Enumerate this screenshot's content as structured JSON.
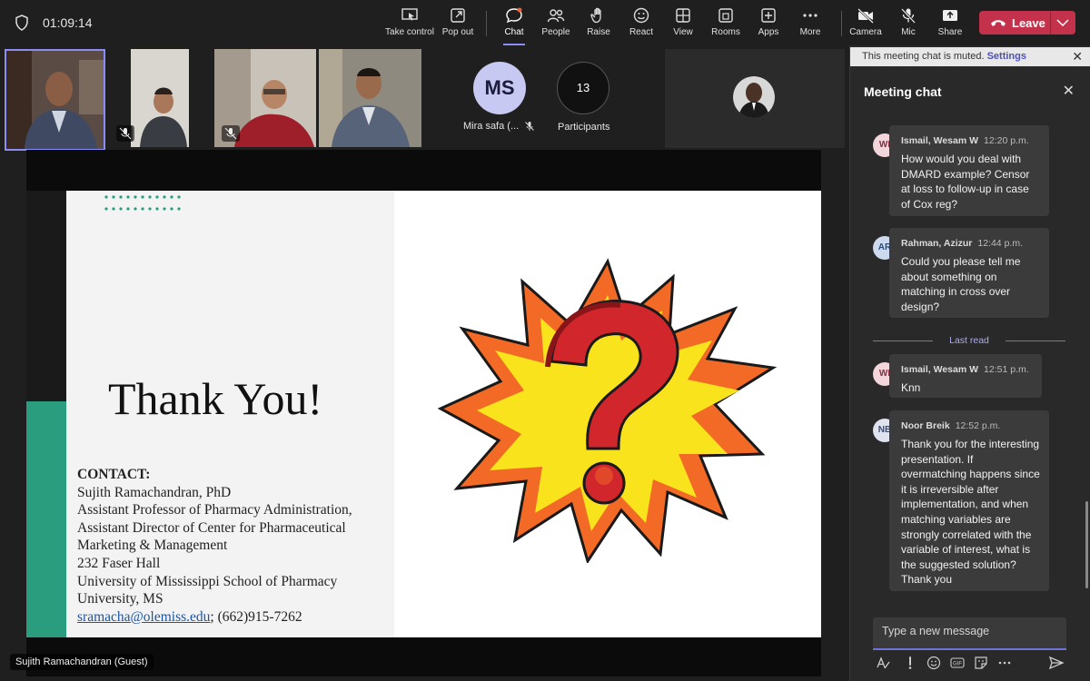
{
  "timer": "01:09:14",
  "toolbar": {
    "take_control": "Take control",
    "pop_out": "Pop out",
    "chat": "Chat",
    "people": "People",
    "raise": "Raise",
    "react": "React",
    "view": "View",
    "rooms": "Rooms",
    "apps": "Apps",
    "more": "More",
    "camera": "Camera",
    "mic": "Mic",
    "share": "Share",
    "leave": "Leave"
  },
  "participants_strip": {
    "avatar_initials": "MS",
    "avatar_name": "Mira safa (...",
    "participant_count": "13",
    "participants_label": "Participants"
  },
  "slide": {
    "thanks": "Thank You!",
    "contact_head": "CONTACT:",
    "contact_lines": [
      "Sujith Ramachandran, PhD",
      "Assistant Professor of Pharmacy Administration,",
      "Assistant Director of Center for Pharmaceutical",
      "Marketing & Management",
      "232 Faser Hall",
      "University of Mississippi School of Pharmacy",
      "University, MS"
    ],
    "email": "sramacha@olemiss.edu",
    "phone": "; (662)915-7262"
  },
  "presenter_label": "Sujith Ramachandran (Guest)",
  "chat_panel": {
    "muted_text": "This meeting chat is muted.",
    "settings": "Settings",
    "title": "Meeting chat",
    "last_read": "Last read",
    "compose_placeholder": "Type a new message",
    "messages": [
      {
        "initials": "WI",
        "author": "Ismail, Wesam W",
        "time": "12:20 p.m.",
        "text": "How would you deal with DMARD example? Censor at loss to follow-up in case of Cox reg?"
      },
      {
        "initials": "AR",
        "author": "Rahman, Azizur",
        "time": "12:44 p.m.",
        "text": "Could you please tell me about something on matching in cross over design?"
      },
      {
        "initials": "WI",
        "author": "Ismail, Wesam W",
        "time": "12:51 p.m.",
        "text": "Knn"
      },
      {
        "initials": "NB",
        "author": "Noor Breik",
        "time": "12:52 p.m.",
        "text": "Thank you for the interesting presentation. If overmatching happens since it is irreversible after implementation,  and when matching variables are strongly correlated with the variable of interest, what is the suggested solution? Thank you"
      }
    ]
  },
  "colors": {
    "accent": "#8b8cf5",
    "leave_red": "#c4314b",
    "slide_green": "#2a9d7f"
  }
}
